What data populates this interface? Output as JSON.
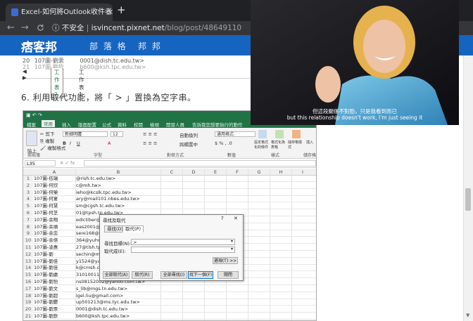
{
  "browser": {
    "tab_title": "Excel-如何將Outlook收件者Ema",
    "tab_close": "✕",
    "new_tab": "+",
    "back": "←",
    "forward": "→",
    "reload": "C",
    "security_label": "不安全",
    "url_domain": "isvincent.pixnet.net",
    "url_path": "/blog/post/48649110"
  },
  "site": {
    "logo": "痞客邦",
    "nav": [
      "部 落 格",
      "邦 邦"
    ]
  },
  "top_fragment": {
    "rows": [
      {
        "num": "20",
        "a": "107圖-劉汞",
        "b": "0001@dish.tc.edu.tw>"
      },
      {
        "num": "21",
        "a": "107圖-劉欽",
        "b": "b600@ksh.tpc.edu.tw>"
      }
    ],
    "sheet_tabs": [
      "工作表2",
      "工作表1"
    ]
  },
  "article": {
    "step_text": "6. 利用取代功能，將「 > 」置換為空字串。"
  },
  "excel": {
    "ribbon_tabs": [
      "檔案",
      "常用",
      "插入",
      "版面配置",
      "公式",
      "資料",
      "校閱",
      "檢視",
      "開發人員",
      "告訴我您想要執行的動作"
    ],
    "font_name": "新細明體",
    "font_size": "12",
    "number_format": "通用格式",
    "group_labels": [
      "剪貼簿",
      "字型",
      "對齊方式",
      "數值",
      "樣式",
      "儲存格"
    ],
    "ribbon_buttons": {
      "paste": "貼上",
      "cut": "剪下",
      "copy": "複製",
      "format_painter": "複製格式",
      "wrap": "自動換列",
      "merge": "跨欄置中",
      "cond_format": "設定格式化的條件",
      "format_table": "格式化為表格",
      "cell_styles": "儲存格樣式",
      "insert": "插入"
    },
    "name_box": "L35",
    "columns": [
      "A",
      "B",
      "C",
      "D",
      "E",
      "F",
      "G",
      "H",
      "I"
    ],
    "rows": [
      {
        "num": "1",
        "a": "107圖-伍瑞",
        "b": "@rish.tc.edu.tw>"
      },
      {
        "num": "2",
        "a": "107圖-何欣",
        "b": "c@mh.tw>"
      },
      {
        "num": "3",
        "a": "107圖-何榮",
        "b": "ieho@kcslk.tpc.edu.tw>"
      },
      {
        "num": "4",
        "a": "107圖-何宴",
        "b": "ary@mail101.nbes.edu.tw>"
      },
      {
        "num": "5",
        "a": "107圖-何慧",
        "b": "sm@cgsh.tc.edu.tw>"
      },
      {
        "num": "6",
        "a": "107圖-何芝",
        "b": "01@tpsh.tp.edu.tw>"
      },
      {
        "num": "7",
        "a": "107圖-余翔",
        "b": "edictiber@gmail.com>"
      },
      {
        "num": "8",
        "a": "107圖-余順",
        "b": "eas2001@gmail.com>"
      },
      {
        "num": "9",
        "a": "107圖-余忠",
        "b": "sere168@gmail.com>"
      },
      {
        "num": "10",
        "a": "107圖-余倍",
        "b": "364@yuhs.ylc.edu.tw>"
      },
      {
        "num": "11",
        "a": "107圖-凌惠",
        "b": "27@tlsh.tp.edu.tw>"
      },
      {
        "num": "12",
        "a": "107圖-劉",
        "b": "sechin@ms28.hinet.net>"
      },
      {
        "num": "13",
        "a": "107圖-劉佳",
        "b": "y1524@yahoo.com.tw>"
      },
      {
        "num": "14",
        "a": "107圖-劉佳",
        "b": "k@cmsh.cyc.edu.tw>"
      },
      {
        "num": "15",
        "a": "107圖-劉處",
        "b": "31010011@gmail.com>"
      },
      {
        "num": "16",
        "a": "107圖-劉怡",
        "b": "ns08152002@yahoo.com.tw>"
      },
      {
        "num": "17",
        "a": "107圖-劉文",
        "b": "s_lib@mgs.tn.edu.tw>"
      },
      {
        "num": "18",
        "a": "107圖-劉超",
        "b": "igel.liu@gmail.com>"
      },
      {
        "num": "19",
        "a": "107圖-劉鬱",
        "b": "up501213@ms.tyc.edu.tw>"
      },
      {
        "num": "20",
        "a": "107圖-劉汞",
        "b": "0001@dish.tc.edu.tw>"
      },
      {
        "num": "21",
        "a": "107圖-劉欽",
        "b": "b600@ksh.tpc.edu.tw>"
      }
    ]
  },
  "dialog": {
    "title": "尋找及取代",
    "help": "?",
    "close": "✕",
    "tabs": [
      "尋找(D)",
      "取代(P)"
    ],
    "find_label": "尋找目標(N):",
    "find_value": ">",
    "replace_label": "取代成(E):",
    "replace_value": "",
    "options_button": "選項(T) >>",
    "buttons": [
      "全部取代(A)",
      "取代(R)",
      "全部尋找(I)",
      "找下一個(F)",
      "關閉"
    ]
  },
  "video": {
    "subtitle_zh": "但這段關係不對勁，只是我看到而已",
    "subtitle_en": "but this relationship doesn't work, I'm just seeing it"
  }
}
